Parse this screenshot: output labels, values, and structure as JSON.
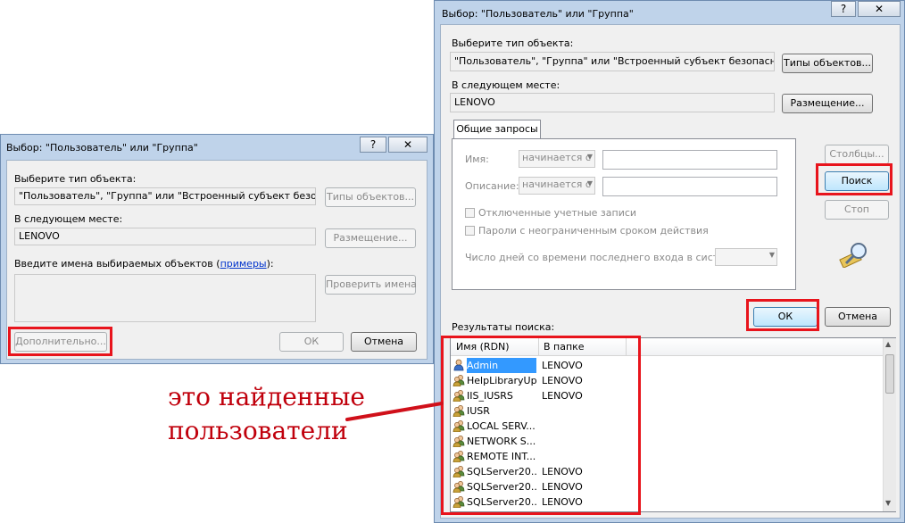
{
  "left_dialog": {
    "title": "Выбор: \"Пользователь\" или \"Группа\"",
    "help_button": "?",
    "close_button": "✕",
    "object_type_label": "Выберите тип объекта:",
    "object_type_value": "\"Пользователь\", \"Группа\" или \"Встроенный субъект безопасности\"",
    "object_types_button": "Типы объектов...",
    "location_label": "В следующем месте:",
    "location_value": "LENOVO",
    "location_button": "Размещение...",
    "enter_names_label_prefix": "Введите имена выбираемых объектов (",
    "examples_link": "примеры",
    "enter_names_label_suffix": "):",
    "check_names_button": "Проверить имена",
    "advanced_button": "Дополнительно...",
    "ok_button": "ОК",
    "cancel_button": "Отмена"
  },
  "right_dialog": {
    "title": "Выбор: \"Пользователь\" или \"Группа\"",
    "help_button": "?",
    "close_button": "✕",
    "object_type_label": "Выберите тип объекта:",
    "object_type_value": "\"Пользователь\", \"Группа\" или \"Встроенный субъект безопасности\"",
    "object_types_button": "Типы объектов...",
    "location_label": "В следующем месте:",
    "location_value": "LENOVO",
    "location_button": "Размещение...",
    "tab_label": "Общие запросы",
    "name_label": "Имя:",
    "name_combo": "начинается с",
    "description_label": "Описание:",
    "description_combo": "начинается с",
    "disabled_accounts": "Отключенные учетные записи",
    "non_expiring_passwords": "Пароли с неограниченным сроком действия",
    "days_since_login_label": "Число дней со времени последнего входа в систему:",
    "columns_button": "Столбцы...",
    "search_button": "Поиск",
    "stop_button": "Стоп",
    "ok_button": "ОК",
    "cancel_button": "Отмена",
    "results_label": "Результаты поиска:",
    "columns": [
      "Имя (RDN)",
      "В папке"
    ],
    "rows": [
      {
        "name": "Admin",
        "folder": "LENOVO",
        "icon": "user-icon"
      },
      {
        "name": "HelpLibraryUp...",
        "folder": "LENOVO",
        "icon": "group-icon"
      },
      {
        "name": "IIS_IUSRS",
        "folder": "LENOVO",
        "icon": "group-icon"
      },
      {
        "name": "IUSR",
        "folder": "",
        "icon": "group-icon"
      },
      {
        "name": "LOCAL SERV...",
        "folder": "",
        "icon": "group-icon"
      },
      {
        "name": "NETWORK S...",
        "folder": "",
        "icon": "group-icon"
      },
      {
        "name": "REMOTE INT...",
        "folder": "",
        "icon": "group-icon"
      },
      {
        "name": "SQLServer20...",
        "folder": "LENOVO",
        "icon": "group-icon"
      },
      {
        "name": "SQLServer20...",
        "folder": "LENOVO",
        "icon": "group-icon"
      },
      {
        "name": "SQLServer20...",
        "folder": "LENOVO",
        "icon": "group-icon"
      }
    ]
  },
  "annotation": {
    "line1": "это найденные",
    "line2": "пользователи",
    "color": "#c0000c"
  },
  "highlight_color": "#e8141c"
}
